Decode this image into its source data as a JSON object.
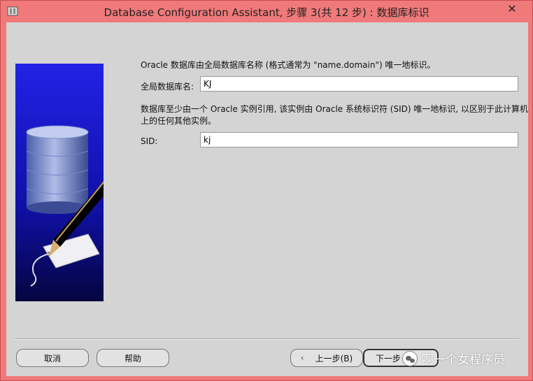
{
  "window": {
    "title": "Database Configuration Assistant, 步骤 3(共 12 步) : 数据库标识",
    "close_glyph": "✕"
  },
  "form": {
    "intro_text": "Oracle 数据库由全局数据库名称 (格式通常为 \"name.domain\") 唯一地标识。",
    "global_db_label": "全局数据库名:",
    "global_db_value": "KJ",
    "sid_description_line1": "数据库至少由一个 Oracle 实例引用, 该实例由 Oracle 系统标识符 (SID) 唯一地标识, 以区别于此计算机",
    "sid_description_line2": "上的任何其他实例。",
    "sid_label": "SID:",
    "sid_value": "kj"
  },
  "buttons": {
    "cancel": "取消",
    "help": "帮助",
    "back": "上一步(B)",
    "back_icon": "chevron-left-icon",
    "next": "下一步"
  },
  "watermark": {
    "text": "啊一个女程序员"
  },
  "colors": {
    "window_frame": "#f0797a",
    "client_bg": "#d4d4d4",
    "banner_blue": "#1a18c8"
  }
}
